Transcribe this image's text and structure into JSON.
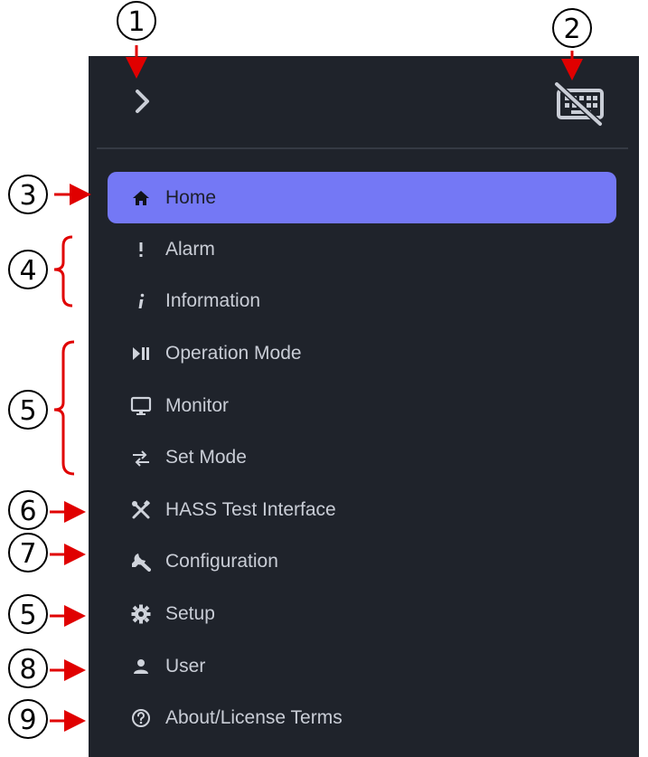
{
  "callouts": [
    "1",
    "2",
    "3",
    "4",
    "5",
    "6",
    "7",
    "5",
    "8",
    "9"
  ],
  "sidebar": {
    "items": [
      {
        "label": "Home",
        "icon": "home-icon",
        "active": true
      },
      {
        "label": "Alarm",
        "icon": "exclamation-icon"
      },
      {
        "label": "Information",
        "icon": "info-icon"
      },
      {
        "label": "Operation Mode",
        "icon": "play-pause-icon"
      },
      {
        "label": "Monitor",
        "icon": "monitor-icon"
      },
      {
        "label": "Set Mode",
        "icon": "swap-icon"
      },
      {
        "label": "HASS Test Interface",
        "icon": "tools-icon"
      },
      {
        "label": "Configuration",
        "icon": "wrench-icon"
      },
      {
        "label": "Setup",
        "icon": "gear-icon"
      },
      {
        "label": "User",
        "icon": "user-icon"
      },
      {
        "label": "About/License Terms",
        "icon": "help-circle-icon"
      }
    ]
  },
  "colors": {
    "panel_bg": "#1f232b",
    "active_bg": "#7478f5",
    "text": "#c9cdd6",
    "arrow": "#e00000"
  }
}
